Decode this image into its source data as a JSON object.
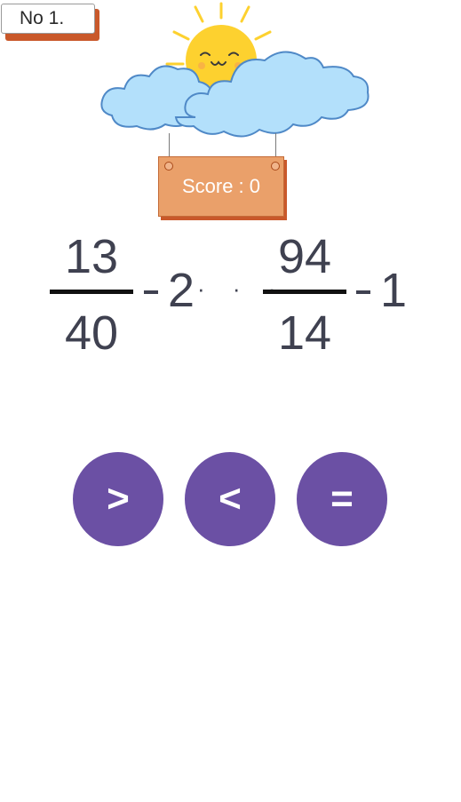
{
  "header": {
    "question_label": "No 1."
  },
  "score": {
    "label": "Score : 0"
  },
  "expression": {
    "left": {
      "numerator": "13",
      "denominator": "40",
      "operator": "-",
      "whole": "2"
    },
    "comparison_placeholder": "· · ·",
    "right": {
      "numerator": "94",
      "denominator": "14",
      "operator": "-",
      "whole": "1"
    }
  },
  "answers": [
    {
      "label": ">"
    },
    {
      "label": "<"
    },
    {
      "label": "="
    }
  ],
  "colors": {
    "button": "#6b50a4",
    "sign": "#eaa06a",
    "sign_shadow": "#c9582a",
    "sun": "#fdd12f",
    "cloud": "#b3e0fb",
    "text": "#3f4150"
  },
  "icons": {
    "hero": "sun-cloud-illustration"
  }
}
